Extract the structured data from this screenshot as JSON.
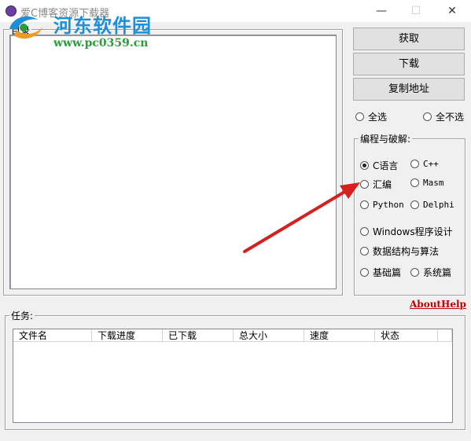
{
  "window": {
    "title": "爱C博客资源下载器",
    "minimize_glyph": "—",
    "maximize_glyph": "☐",
    "close_glyph": "✕"
  },
  "watermark": {
    "site_name": "河东软件园",
    "url": "www.pc0359.cn"
  },
  "directory_group": {
    "label": "目录"
  },
  "buttons": {
    "fetch": "获取",
    "download": "下载",
    "copy_address": "复制地址"
  },
  "selection": {
    "select_all": "全选",
    "select_none": "全不选"
  },
  "category_group": {
    "label": "编程与破解:",
    "options": [
      {
        "label": "C语言",
        "checked": true
      },
      {
        "label": "C++",
        "checked": false
      },
      {
        "label": "汇编",
        "checked": false
      },
      {
        "label": "Masm",
        "checked": false
      },
      {
        "label": "Python",
        "checked": false
      },
      {
        "label": "Delphi",
        "checked": false
      },
      {
        "label": "Windows程序设计",
        "checked": false
      },
      {
        "label": "数据结构与算法",
        "checked": false
      },
      {
        "label": "基础篇",
        "checked": false
      },
      {
        "label": "系统篇",
        "checked": false
      }
    ]
  },
  "links": {
    "about": "About",
    "help": "Help"
  },
  "task_group": {
    "label": "任务:",
    "columns": [
      "文件名",
      "下载进度",
      "已下载",
      "总大小",
      "速度",
      "状态"
    ]
  },
  "colors": {
    "link_red": "#c00000",
    "watermark_blue": "#1c8fd8",
    "watermark_green": "#2a9d3a",
    "arrow_red": "#d42020"
  }
}
